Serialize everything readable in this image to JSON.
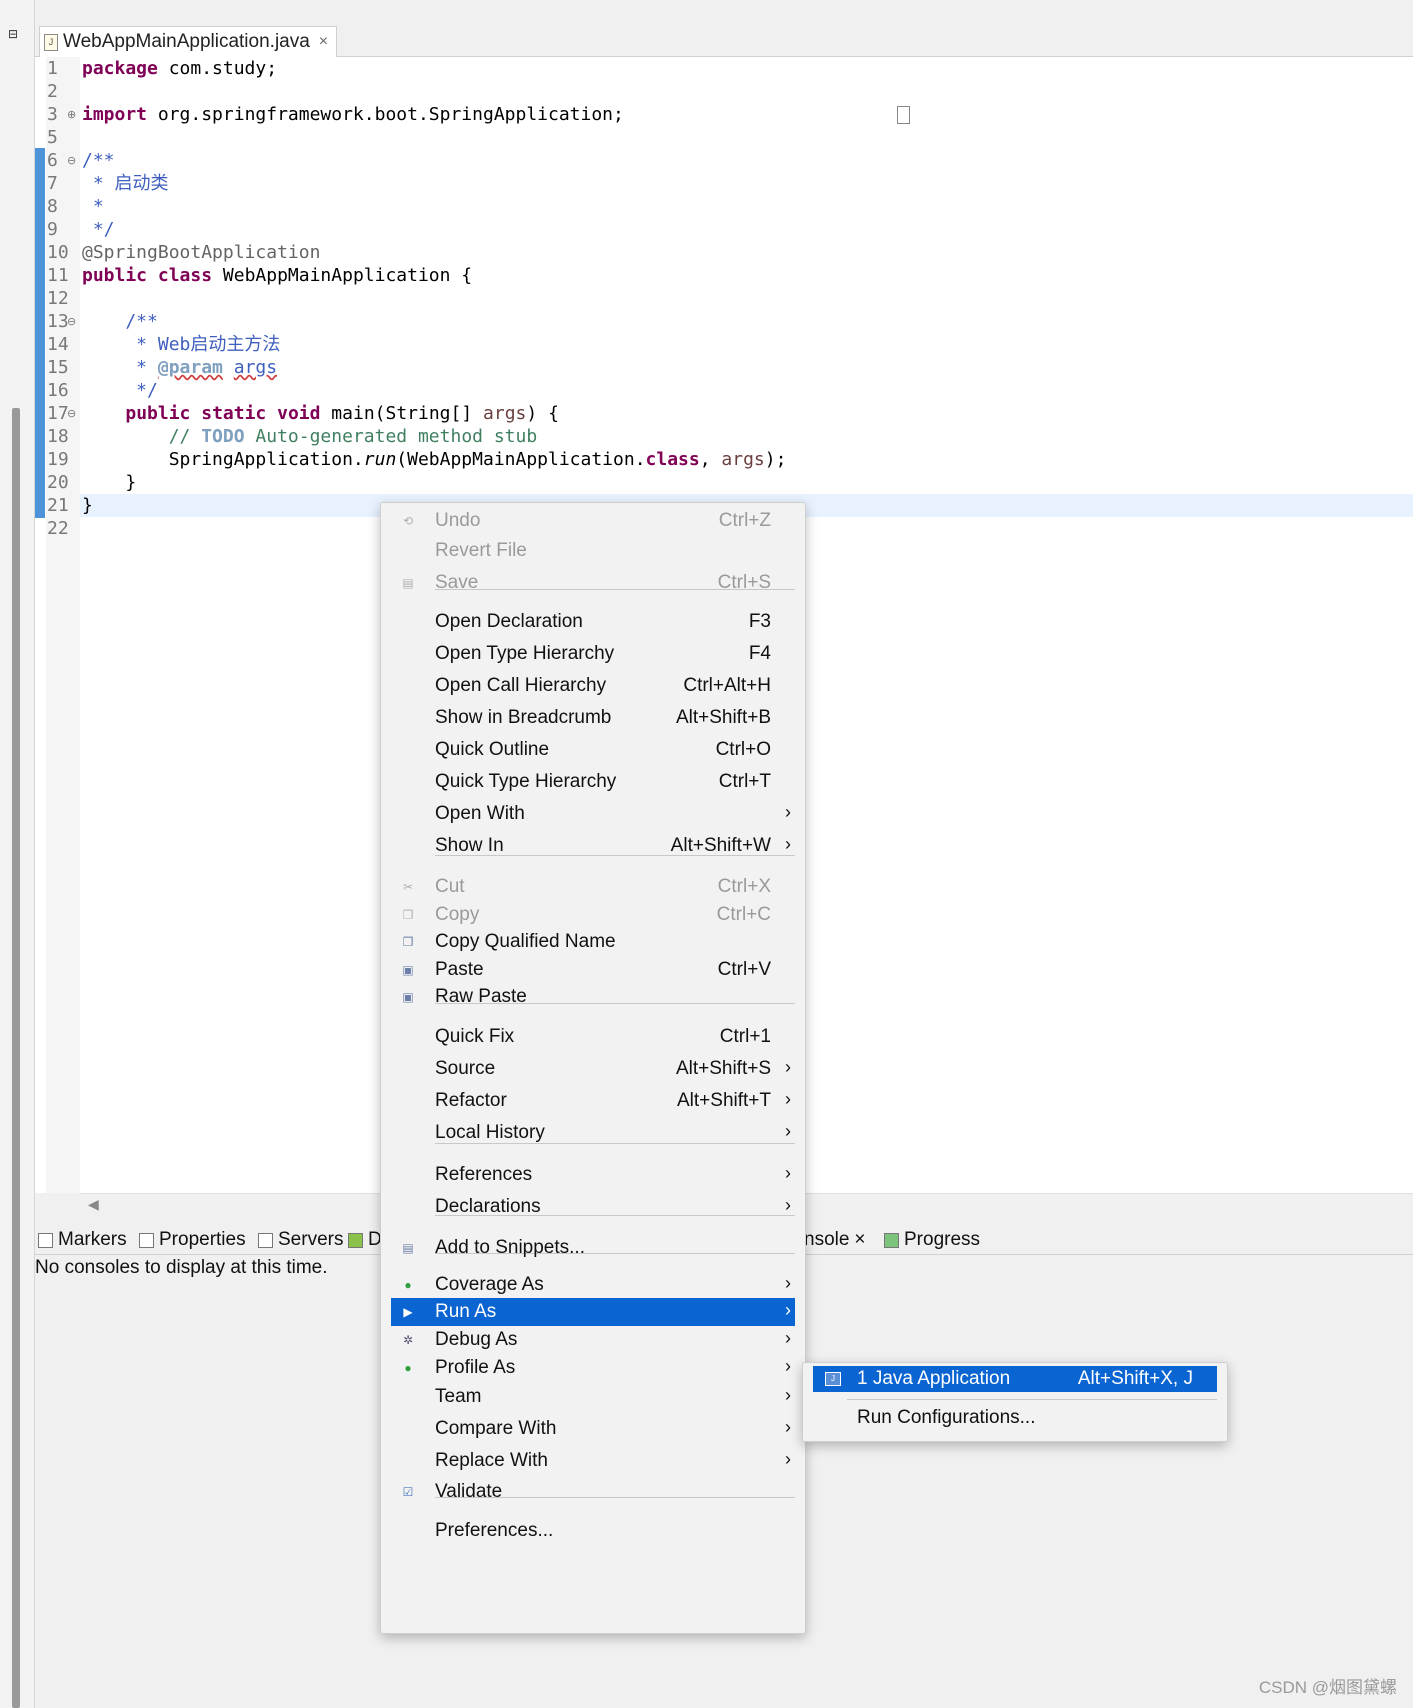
{
  "editor": {
    "tab_title": "WebAppMainApplication.java",
    "tab_close": "×",
    "lines": [
      {
        "n": "1",
        "text": "package com.study;"
      },
      {
        "n": "2",
        "text": ""
      },
      {
        "n": "3",
        "text": "import org.springframework.boot.SpringApplication;"
      },
      {
        "n": "5",
        "text": ""
      },
      {
        "n": "6",
        "text": "/**"
      },
      {
        "n": "7",
        "text": " * 启动类"
      },
      {
        "n": "8",
        "text": " *"
      },
      {
        "n": "9",
        "text": " */"
      },
      {
        "n": "10",
        "text": "@SpringBootApplication"
      },
      {
        "n": "11",
        "text": "public class WebAppMainApplication {"
      },
      {
        "n": "12",
        "text": ""
      },
      {
        "n": "13",
        "text": "    /**"
      },
      {
        "n": "14",
        "text": "     * Web启动主方法"
      },
      {
        "n": "15",
        "text": "     * @param args"
      },
      {
        "n": "16",
        "text": "     */"
      },
      {
        "n": "17",
        "text": "    public static void main(String[] args) {"
      },
      {
        "n": "18",
        "text": "        // TODO Auto-generated method stub"
      },
      {
        "n": "19",
        "text": "        SpringApplication.run(WebAppMainApplication.class, args);"
      },
      {
        "n": "20",
        "text": "    }"
      },
      {
        "n": "21",
        "text": "}"
      },
      {
        "n": "22",
        "text": ""
      }
    ]
  },
  "bottom_panel": {
    "tabs": [
      {
        "label": "Markers",
        "icon": "markers-icon"
      },
      {
        "label": "Properties",
        "icon": "properties-icon"
      },
      {
        "label": "Servers",
        "icon": "servers-icon"
      },
      {
        "label": "D",
        "icon": "data-source-icon"
      },
      {
        "label": "nsole",
        "icon": "console-icon"
      },
      {
        "label": "Progress",
        "icon": "progress-icon"
      }
    ],
    "console_close": "×",
    "message": "No consoles to display at this time."
  },
  "context_menu": {
    "items": [
      {
        "label": "Undo",
        "shortcut": "Ctrl+Z",
        "disabled": true,
        "icon": "undo-icon"
      },
      {
        "label": "Revert File",
        "shortcut": "",
        "disabled": true
      },
      {
        "label": "Save",
        "shortcut": "Ctrl+S",
        "disabled": true,
        "icon": "save-icon"
      },
      {
        "label": "Open Declaration",
        "shortcut": "F3"
      },
      {
        "label": "Open Type Hierarchy",
        "shortcut": "F4"
      },
      {
        "label": "Open Call Hierarchy",
        "shortcut": "Ctrl+Alt+H"
      },
      {
        "label": "Show in Breadcrumb",
        "shortcut": "Alt+Shift+B"
      },
      {
        "label": "Quick Outline",
        "shortcut": "Ctrl+O"
      },
      {
        "label": "Quick Type Hierarchy",
        "shortcut": "Ctrl+T"
      },
      {
        "label": "Open With",
        "shortcut": "",
        "submenu": true
      },
      {
        "label": "Show In",
        "shortcut": "Alt+Shift+W",
        "submenu": true
      },
      {
        "label": "Cut",
        "shortcut": "Ctrl+X",
        "disabled": true,
        "icon": "cut-icon"
      },
      {
        "label": "Copy",
        "shortcut": "Ctrl+C",
        "disabled": true,
        "icon": "copy-icon"
      },
      {
        "label": "Copy Qualified Name",
        "shortcut": "",
        "icon": "copy-qualified-name-icon"
      },
      {
        "label": "Paste",
        "shortcut": "Ctrl+V",
        "icon": "paste-icon"
      },
      {
        "label": "Raw Paste",
        "shortcut": "",
        "icon": "raw-paste-icon"
      },
      {
        "label": "Quick Fix",
        "shortcut": "Ctrl+1"
      },
      {
        "label": "Source",
        "shortcut": "Alt+Shift+S",
        "submenu": true
      },
      {
        "label": "Refactor",
        "shortcut": "Alt+Shift+T",
        "submenu": true
      },
      {
        "label": "Local History",
        "shortcut": "",
        "submenu": true
      },
      {
        "label": "References",
        "shortcut": "",
        "submenu": true
      },
      {
        "label": "Declarations",
        "shortcut": "",
        "submenu": true
      },
      {
        "label": "Add to Snippets...",
        "shortcut": "",
        "icon": "snippets-icon"
      },
      {
        "label": "Coverage As",
        "shortcut": "",
        "submenu": true,
        "icon": "coverage-icon"
      },
      {
        "label": "Run As",
        "shortcut": "",
        "submenu": true,
        "selected": true,
        "icon": "run-icon"
      },
      {
        "label": "Debug As",
        "shortcut": "",
        "submenu": true,
        "icon": "debug-icon"
      },
      {
        "label": "Profile As",
        "shortcut": "",
        "submenu": true,
        "icon": "profile-icon"
      },
      {
        "label": "Team",
        "shortcut": "",
        "submenu": true
      },
      {
        "label": "Compare With",
        "shortcut": "",
        "submenu": true
      },
      {
        "label": "Replace With",
        "shortcut": "",
        "submenu": true
      },
      {
        "label": "Validate",
        "shortcut": "",
        "icon": "validate-checkbox-icon"
      },
      {
        "label": "Preferences...",
        "shortcut": ""
      }
    ],
    "arrow": "›"
  },
  "run_as_submenu": {
    "items": [
      {
        "label": "1 Java Application",
        "shortcut": "Alt+Shift+X, J",
        "selected": true
      },
      {
        "label": "Run Configurations...",
        "shortcut": ""
      }
    ]
  },
  "watermark": "CSDN @烟图黛螺",
  "colors": {
    "selection": "#0a64d2",
    "keyword": "#7f0055",
    "comment": "#3f5fbf",
    "line_comment": "#3f7f5f",
    "ruler": "#4d93d9"
  }
}
